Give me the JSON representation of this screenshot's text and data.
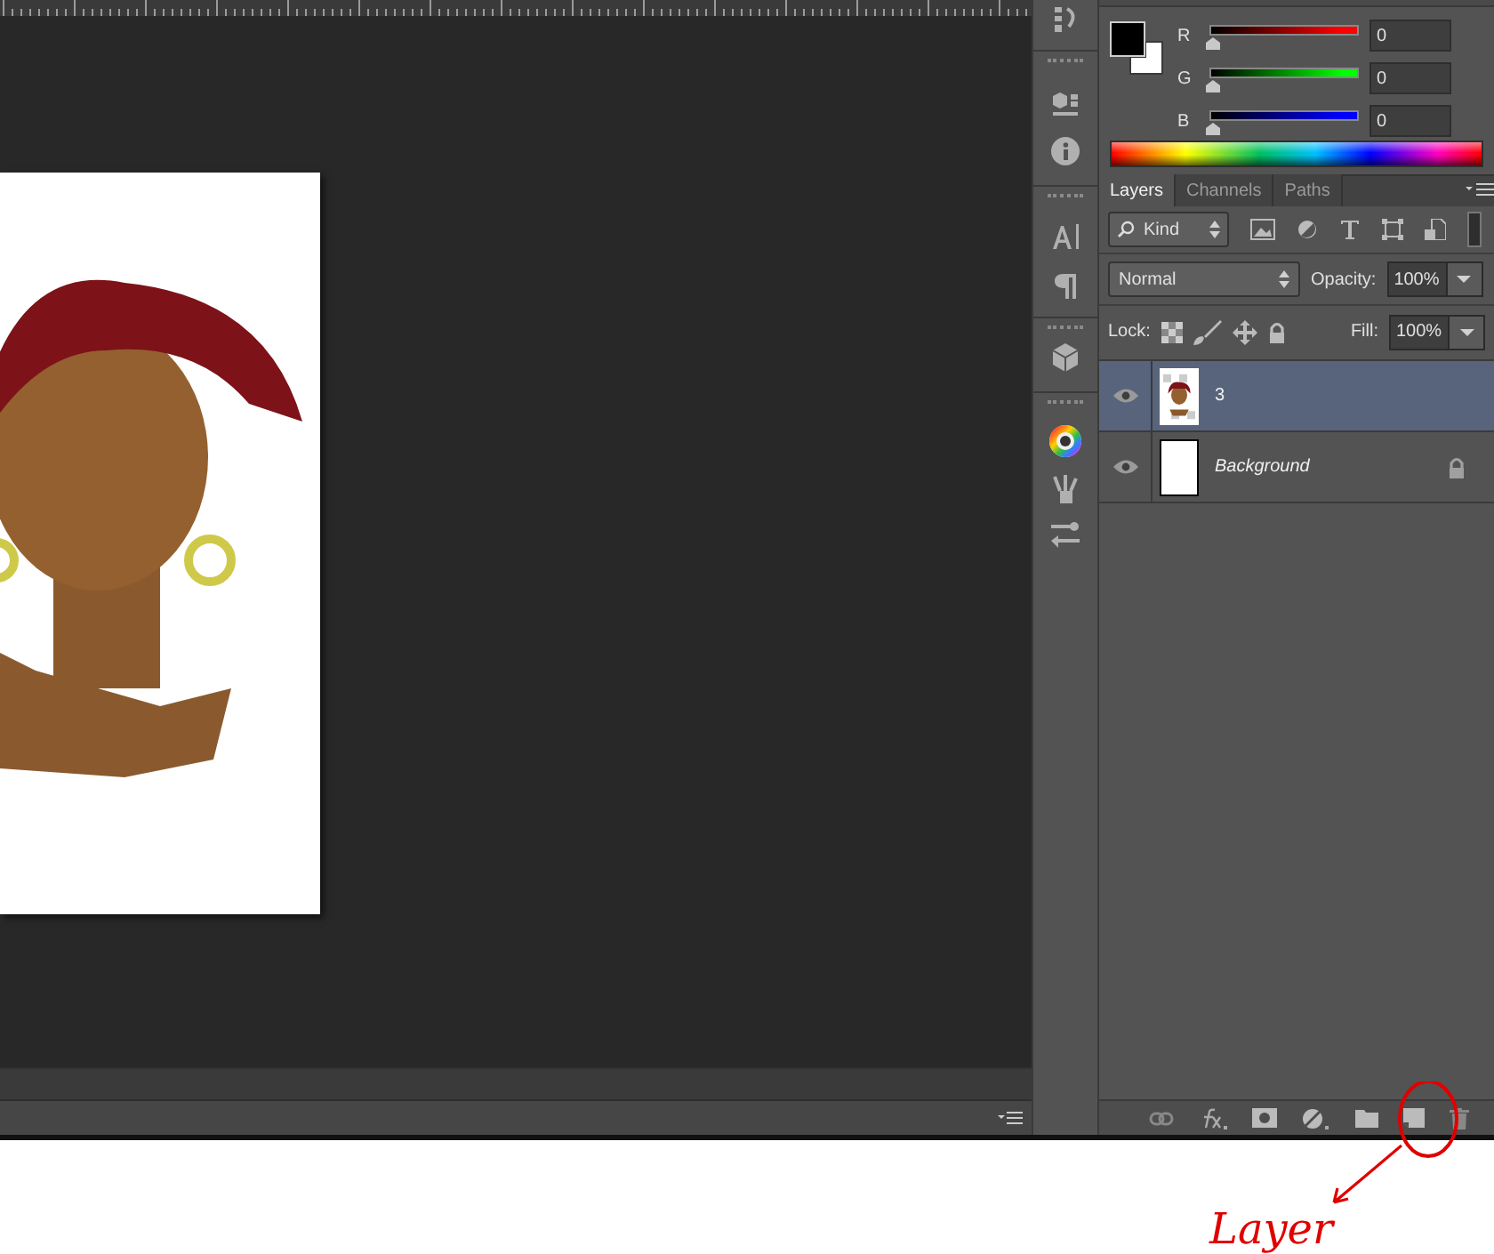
{
  "color_panel": {
    "channels": [
      {
        "label": "R",
        "value": "0",
        "level": 0,
        "color": "#ff0000"
      },
      {
        "label": "G",
        "value": "0",
        "level": 0,
        "color": "#00ff00"
      },
      {
        "label": "B",
        "value": "0",
        "level": 0,
        "color": "#0000ff"
      }
    ]
  },
  "layers_panel": {
    "tabs": [
      {
        "label": "Layers",
        "selected": true
      },
      {
        "label": "Channels",
        "selected": false
      },
      {
        "label": "Paths",
        "selected": false
      }
    ],
    "filter": "Kind",
    "blend_mode": "Normal",
    "opacity_label": "Opacity:",
    "opacity": "100%",
    "lock_label": "Lock:",
    "fill_label": "Fill:",
    "fill": "100%",
    "layers": [
      {
        "name": "3",
        "kind": "pixel",
        "selected": true,
        "visible": true,
        "locked": false
      },
      {
        "name": "Background",
        "kind": "background",
        "selected": false,
        "visible": true,
        "locked": true
      }
    ]
  },
  "annotation": {
    "text": "Layer"
  }
}
